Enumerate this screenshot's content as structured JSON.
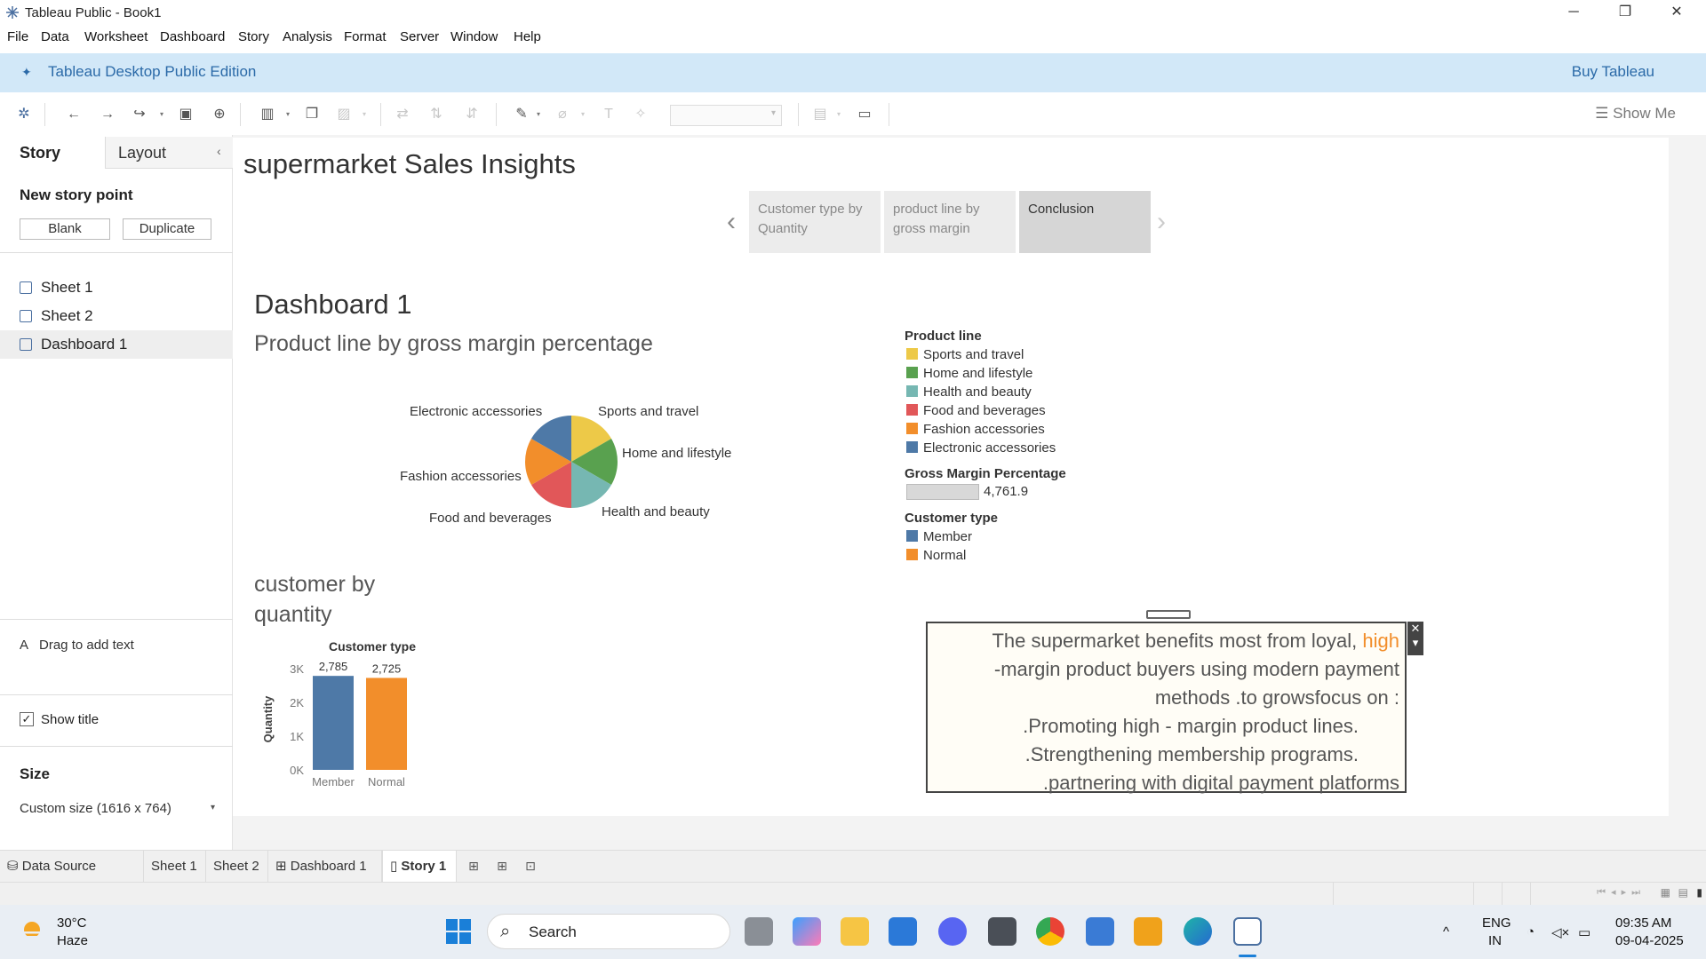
{
  "window": {
    "title": "Tableau Public - Book1",
    "controls": [
      "─",
      "❐",
      "✕"
    ]
  },
  "menu": [
    "File",
    "Data",
    "Worksheet",
    "Dashboard",
    "Story",
    "Analysis",
    "Format",
    "Server",
    "Window",
    "Help"
  ],
  "banner": {
    "edition": "Tableau Desktop Public Edition",
    "buy": "Buy Tableau"
  },
  "toolbar": {
    "show_me": "Show Me"
  },
  "left_panel": {
    "tabs": {
      "story": "Story",
      "layout": "Layout"
    },
    "new_story_point": "New story point",
    "blank": "Blank",
    "duplicate": "Duplicate",
    "sheets": [
      "Sheet 1",
      "Sheet 2",
      "Dashboard 1"
    ],
    "drag_text": "Drag to add text",
    "show_title": "Show title",
    "size_label": "Size",
    "size_value": "Custom size (1616 x 764)"
  },
  "story": {
    "title": "supermarket Sales Insights",
    "points": [
      "Customer type by Quantity",
      "product line by gross margin",
      "Conclusion"
    ],
    "active_point": 2
  },
  "dashboard": {
    "title": "Dashboard 1",
    "pie_title": "Product line by gross margin percentage",
    "bar_title_1": "customer by",
    "bar_title_2": "quantity"
  },
  "legend": {
    "product_line_title": "Product line",
    "product_lines": [
      {
        "name": "Sports and travel",
        "color": "#edc948"
      },
      {
        "name": "Home and lifestyle",
        "color": "#59a14f"
      },
      {
        "name": "Health and beauty",
        "color": "#76b7b2"
      },
      {
        "name": "Food and beverages",
        "color": "#e15759"
      },
      {
        "name": "Fashion accessories",
        "color": "#f28e2b"
      },
      {
        "name": "Electronic accessories",
        "color": "#4e79a7"
      }
    ],
    "gross_margin_title": "Gross Margin Percentage",
    "gross_margin_value": "4,761.9",
    "customer_type_title": "Customer type",
    "customer_types": [
      {
        "name": "Member",
        "color": "#4e79a7"
      },
      {
        "name": "Normal",
        "color": "#f28e2b"
      }
    ]
  },
  "conclusion": {
    "line1_a": "The supermarket benefits most from loyal, ",
    "line1_b": "high",
    "line2": "-margin product buyers using modern payment",
    "line3": "methods .to growsfocus on :",
    "line4": ".Promoting high - margin product lines.",
    "line5": ".Strengthening membership programs.",
    "line6": ".partnering with digital payment platforms"
  },
  "chart_data": [
    {
      "type": "pie",
      "title": "Product line by gross margin percentage",
      "labels": [
        "Sports and travel",
        "Home and lifestyle",
        "Health and beauty",
        "Food and beverages",
        "Fashion accessories",
        "Electronic accessories"
      ],
      "values": [
        16.7,
        16.7,
        16.7,
        16.7,
        16.7,
        16.7
      ],
      "colors": [
        "#edc948",
        "#59a14f",
        "#76b7b2",
        "#e15759",
        "#f28e2b",
        "#4e79a7"
      ]
    },
    {
      "type": "bar",
      "title": "customer by quantity",
      "header": "Customer type",
      "categories": [
        "Member",
        "Normal"
      ],
      "values": [
        2785,
        2725
      ],
      "value_labels": [
        "2,785",
        "2,725"
      ],
      "colors": [
        "#4e79a7",
        "#f28e2b"
      ],
      "ylabel": "Quantity",
      "yticks": [
        "0K",
        "1K",
        "2K",
        "3K"
      ],
      "ylim": [
        0,
        3000
      ]
    }
  ],
  "bottom_tabs": [
    "Data Source",
    "Sheet 1",
    "Sheet 2",
    "Dashboard 1",
    "Story 1"
  ],
  "taskbar": {
    "temp": "30°C",
    "weather": "Haze",
    "search": "Search",
    "lang1": "ENG",
    "lang2": "IN",
    "time": "09:35 AM",
    "date": "09-04-2025"
  }
}
